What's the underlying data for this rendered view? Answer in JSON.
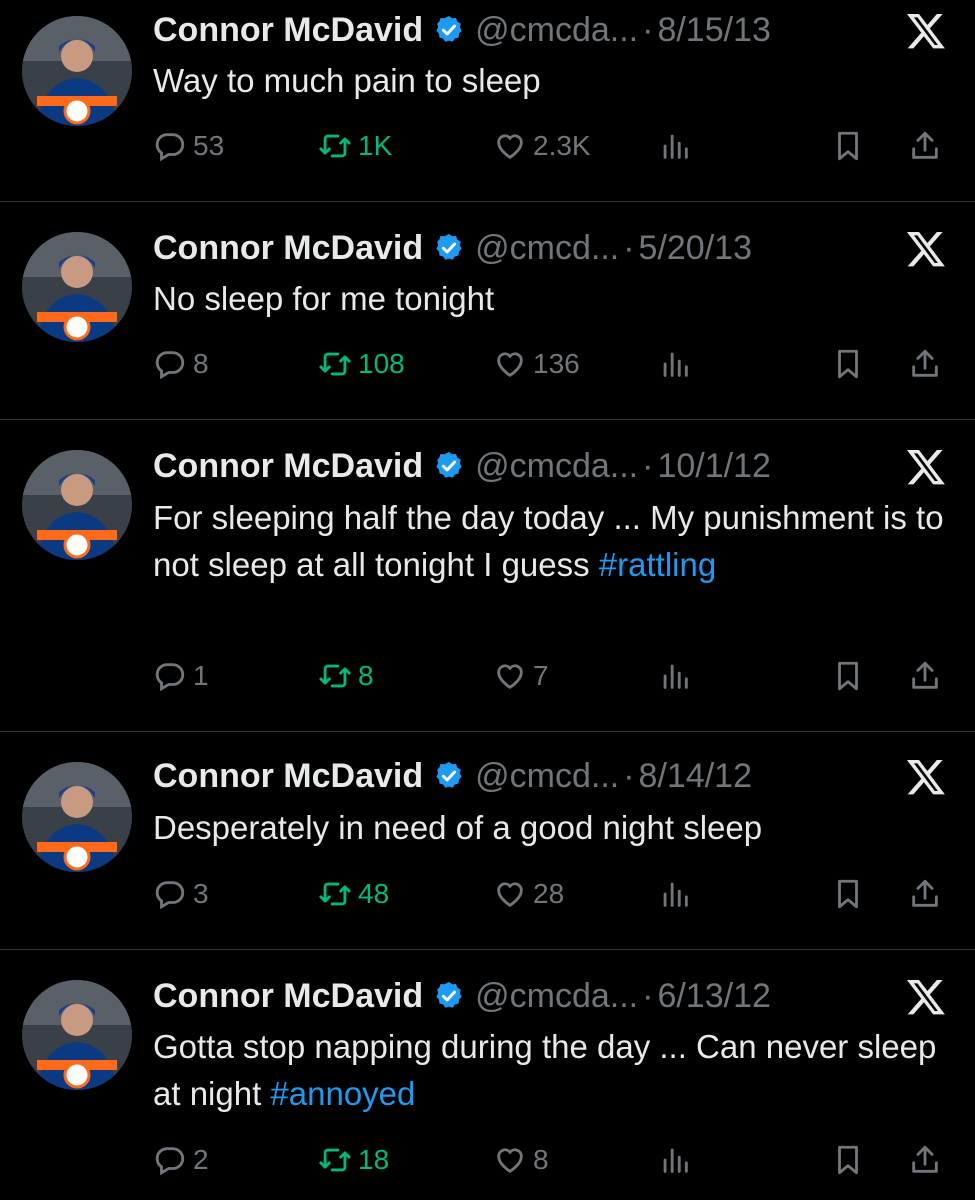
{
  "tweets": [
    {
      "name": "Connor McDavid",
      "handle": "@cmcda...",
      "date": "8/15/13",
      "text": "Way to much pain to sleep",
      "hashtag": "",
      "replies": "53",
      "retweets": "1K",
      "likes": "2.3K"
    },
    {
      "name": "Connor McDavid",
      "handle": "@cmcd...",
      "date": "5/20/13",
      "text": "No sleep for me tonight",
      "hashtag": "",
      "replies": "8",
      "retweets": "108",
      "likes": "136"
    },
    {
      "name": "Connor McDavid",
      "handle": "@cmcda...",
      "date": "10/1/12",
      "text": "For sleeping half the day today ... My punishment is to not sleep at all tonight I guess",
      "hashtag": "#rattling",
      "replies": "1",
      "retweets": "8",
      "likes": "7"
    },
    {
      "name": "Connor McDavid",
      "handle": "@cmcd...",
      "date": "8/14/12",
      "text": "Desperately in need of a good night sleep",
      "hashtag": "",
      "replies": "3",
      "retweets": "48",
      "likes": "28"
    },
    {
      "name": "Connor McDavid",
      "handle": "@cmcda...",
      "date": "6/13/12",
      "text": "Gotta stop napping during the day ... Can never sleep at night",
      "hashtag": "#annoyed",
      "replies": "2",
      "retweets": "18",
      "likes": "8"
    }
  ],
  "separator": "·",
  "colors": {
    "background": "#000000",
    "text": "#e7e9ea",
    "muted": "#71767b",
    "link": "#1d9bf0",
    "retweet": "#00ba7c",
    "verified": "#1d9bf0",
    "divider": "#2f3336"
  },
  "icons": [
    "reply-icon",
    "retweet-icon",
    "like-icon",
    "views-icon",
    "bookmark-icon",
    "share-icon",
    "verified-badge-icon",
    "x-logo-icon"
  ]
}
